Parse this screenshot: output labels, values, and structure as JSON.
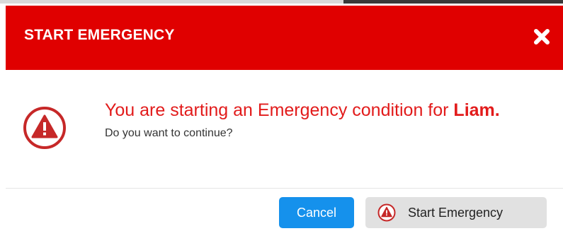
{
  "dialog": {
    "title": "START EMERGENCY",
    "close_icon": "close-icon",
    "message_prefix": "You are starting an Emergency condition for ",
    "target_name": "Liam.",
    "question": "Do you want to continue?",
    "alert_icon": "warning-triangle-icon"
  },
  "buttons": {
    "cancel_label": "Cancel",
    "start_label": "Start Emergency",
    "start_icon": "warning-triangle-icon"
  },
  "colors": {
    "header_bg": "#e00000",
    "accent_red": "#e21b1b",
    "cancel_bg": "#1591ec",
    "start_bg": "#e1e1e1"
  }
}
